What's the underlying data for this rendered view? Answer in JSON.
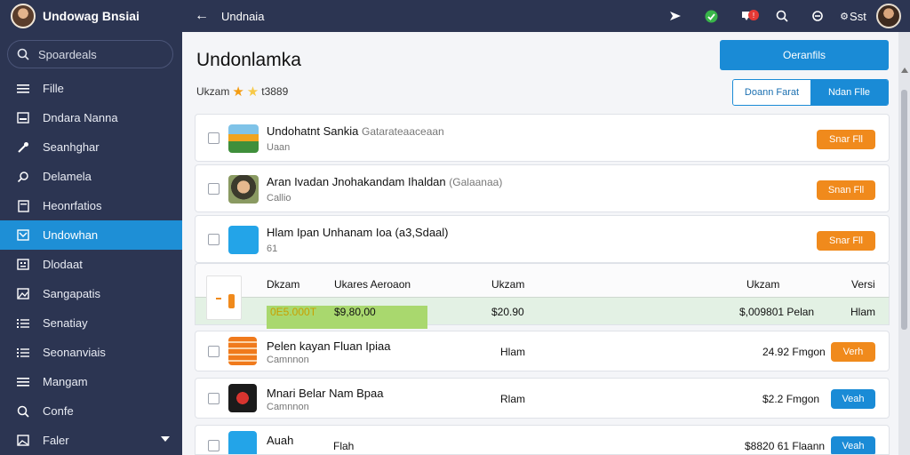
{
  "sidebar": {
    "title": "Undowag Bnsiai",
    "search_label": "Spoardeals",
    "items": [
      {
        "label": "Fille",
        "icon": "menu-icon"
      },
      {
        "label": "Dndara Nanna",
        "icon": "image-icon"
      },
      {
        "label": "Seanhghar",
        "icon": "wrench-icon"
      },
      {
        "label": "Delamela",
        "icon": "search-icon"
      },
      {
        "label": "Heonrfatios",
        "icon": "document-icon"
      },
      {
        "label": "Undowhan",
        "icon": "inbox-icon"
      },
      {
        "label": "Dlodaat",
        "icon": "grid-icon"
      },
      {
        "label": "Sangapatis",
        "icon": "gallery-icon"
      },
      {
        "label": "Senatiay",
        "icon": "list-icon"
      },
      {
        "label": "Seonanviais",
        "icon": "list-icon"
      },
      {
        "label": "Mangam",
        "icon": "menu-icon"
      },
      {
        "label": "Confe",
        "icon": "search-icon"
      },
      {
        "label": "Faler",
        "icon": "image-icon"
      }
    ],
    "active_index": 5
  },
  "topbar": {
    "title": "Undnaia",
    "settings_label": "Sst"
  },
  "main": {
    "title": "Undonlamka",
    "rating_prefix": "Ukzam",
    "rating_value": "t3889",
    "primary_button": "Oeranfils",
    "segment": [
      "Doann Farat",
      "Ndan Flle"
    ],
    "cards": [
      {
        "title": "Undohatnt Sankia",
        "title_muted": "Gatarateaaceaan",
        "sub": "Uaan",
        "button": "Snar Fll",
        "thumb": "flowers"
      },
      {
        "title": "Aran Ivadan Jnohakandam Ihaldan",
        "title_muted": "(Galaanaa)",
        "sub": "Callio",
        "button": "Snan Fll",
        "thumb": "portrait"
      },
      {
        "title": "Hlam Ipan Unhanam Ioa (a3,Sdaal)",
        "title_muted": "",
        "sub": "61",
        "button": "Snar Fll",
        "thumb": "logo"
      }
    ],
    "table": {
      "headers": [
        "Dkzam",
        "Ukares Aeroaon",
        "Ukzam",
        "Ukzam",
        "Versi"
      ],
      "row": [
        "0E5.000T",
        "$9,80,00",
        "$20.90",
        "$,009801 Pelan",
        "Hlam"
      ]
    },
    "products": [
      {
        "title": "Pelen kayan Fluan Ipiaa",
        "sub": "Camnnon",
        "col1": "Hlam",
        "price": "24.92 Fmgon",
        "button": "Verh",
        "button_style": "orange",
        "thumb": "orange"
      },
      {
        "title": "Mnari Belar Nam Bpaa",
        "sub": "Camnnon",
        "col1": "Rlam",
        "price": "$2.2 Fmgon",
        "button": "Veah",
        "button_style": "blue",
        "thumb": "dark"
      },
      {
        "title": "Auah",
        "sub": "",
        "col1": "Flah",
        "price": "$8820 61 Flaann",
        "button": "Veah",
        "button_style": "blue",
        "thumb": "logo"
      }
    ]
  },
  "colors": {
    "nav": "#2c3552",
    "accent": "#1a8bd6",
    "orange": "#f08a1c",
    "green": "#a9d86e"
  }
}
